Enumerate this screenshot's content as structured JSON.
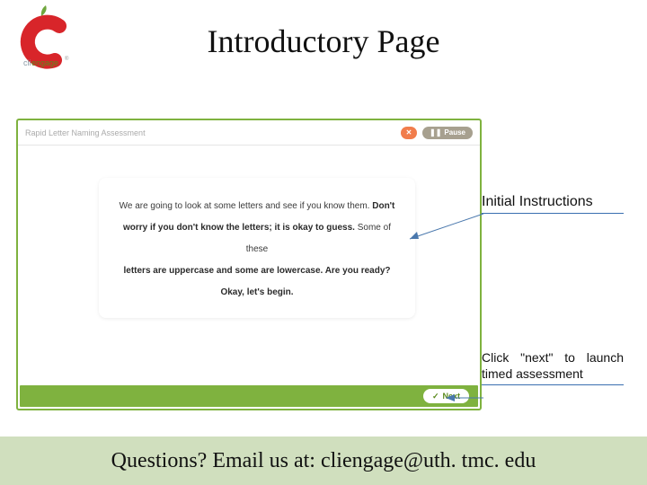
{
  "logo": {
    "main_text": "engage",
    "subtype": "cli"
  },
  "title": "Introductory Page",
  "app": {
    "header": {
      "title": "Rapid Letter Naming Assessment",
      "close_icon": "✕",
      "pause_icon": "❚❚",
      "pause_label": "Pause"
    },
    "instructions": {
      "line1_a": "We are going to look at some letters and see if you know them. ",
      "line1_b": "Don't",
      "line2_a": "worry if you don't know the letters; it is okay to guess.",
      "line2_b": " Some of these",
      "line3": "letters are uppercase and some are lowercase. Are you ready?",
      "line4": "Okay, let's begin."
    },
    "footer": {
      "next_icon": "✓",
      "next_label": "Next"
    }
  },
  "callouts": {
    "initial_instructions": "Initial Instructions",
    "click_next": "Click \"next\" to launch timed assessment"
  },
  "footer_bar": "Questions?  Email us at: cliengage@uth. tmc. edu"
}
